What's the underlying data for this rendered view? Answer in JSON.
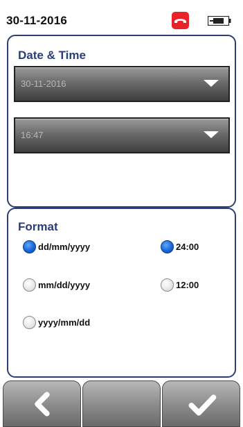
{
  "status_bar": {
    "date": "30-11-2016",
    "phone_icon": "phone-hangup-icon",
    "battery_icon": "battery-icon"
  },
  "date_time_panel": {
    "title": "Date & Time",
    "date_value": "30-11-2016",
    "time_value": "16:47"
  },
  "format_panel": {
    "title": "Format",
    "date_formats": [
      {
        "label": "dd/mm/yyyy",
        "selected": true
      },
      {
        "label": "mm/dd/yyyy",
        "selected": false
      },
      {
        "label": "yyyy/mm/dd",
        "selected": false
      }
    ],
    "time_formats": [
      {
        "label": "24:00",
        "selected": true
      },
      {
        "label": "12:00",
        "selected": false
      }
    ]
  },
  "bottom_nav": {
    "back_icon": "chevron-left-icon",
    "confirm_icon": "checkmark-icon"
  },
  "colors": {
    "accent": "#2a3c7a",
    "panel_border": "#2c3e75",
    "phone_red": "#e8232a",
    "radio_selected": "#1a66d6"
  }
}
